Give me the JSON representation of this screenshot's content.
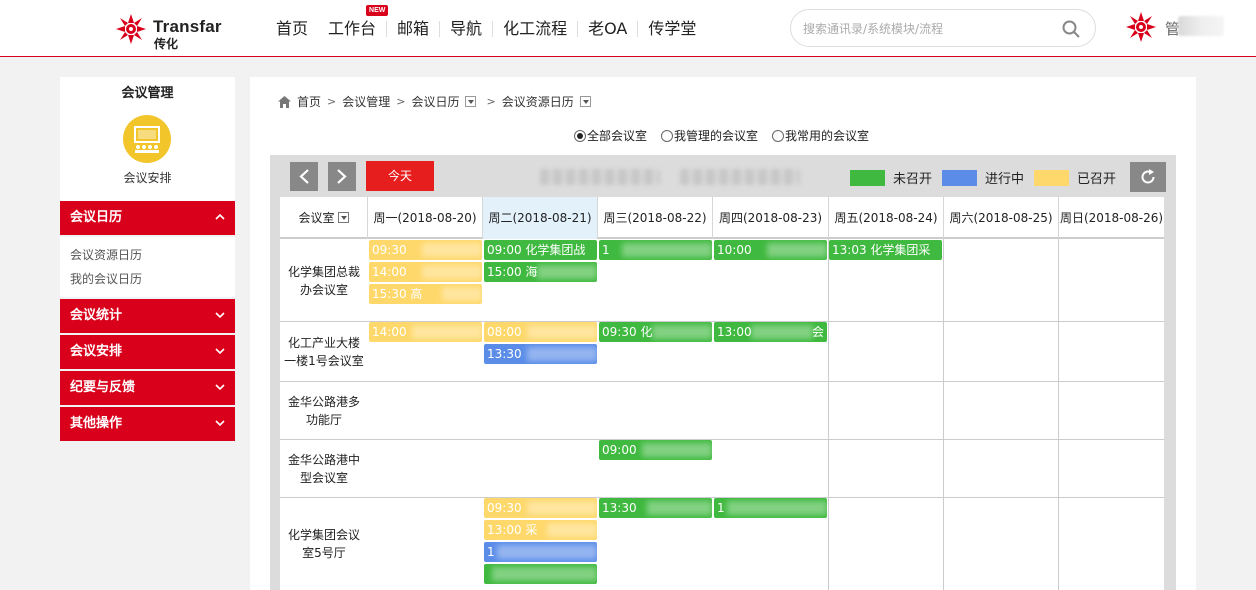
{
  "header": {
    "brand_en": "Transfar",
    "brand_cn": "传化",
    "nav": [
      {
        "label": "首页"
      },
      {
        "label": "工作台",
        "badge": "NEW"
      },
      {
        "label": "邮箱"
      },
      {
        "label": "导航"
      },
      {
        "label": "化工流程"
      },
      {
        "label": "老OA"
      },
      {
        "label": "传学堂"
      }
    ],
    "search_placeholder": "搜索通讯录/系统模块/流程",
    "user_name": "管"
  },
  "sidebar": {
    "title": "会议管理",
    "icon_label": "会议安排",
    "menus": [
      {
        "label": "会议日历",
        "expanded": true,
        "items": [
          "会议资源日历",
          "我的会议日历"
        ]
      },
      {
        "label": "会议统计"
      },
      {
        "label": "会议安排"
      },
      {
        "label": "纪要与反馈"
      },
      {
        "label": "其他操作"
      }
    ]
  },
  "breadcrumb": [
    "首页",
    "会议管理",
    "会议日历",
    "会议资源日历"
  ],
  "room_filter": {
    "options": [
      "全部会议室",
      "我管理的会议室",
      "我常用的会议室"
    ],
    "selected": "全部会议室"
  },
  "calendar": {
    "today_label": "今天",
    "legend": [
      {
        "label": "未召开",
        "color": "#3fb93f"
      },
      {
        "label": "进行中",
        "color": "#5b8de8"
      },
      {
        "label": "已召开",
        "color": "#ffd86b"
      }
    ],
    "room_header": "会议室",
    "days": [
      "周一(2018-08-20)",
      "周二(2018-08-21)",
      "周三(2018-08-22)",
      "周四(2018-08-23)",
      "周五(2018-08-24)",
      "周六(2018-08-25)",
      "周日(2018-08-26)"
    ],
    "today_index": 1,
    "rooms": [
      {
        "name": "化学集团总裁办会议室"
      },
      {
        "name": "化工产业大楼一楼1号会议室"
      },
      {
        "name": "金华公路港多功能厅"
      },
      {
        "name": "金华公路港中型会议室"
      },
      {
        "name": "化学集团会议室5号厅"
      }
    ],
    "events": {
      "e0": "09:30 ",
      "e1": "14:00 ",
      "e2": "15:30 高",
      "e3": "09:00 化学集团战",
      "e4": "15:00 海",
      "e5": "1",
      "e6": "10:00 ",
      "e7": "13:03 化学集团采",
      "e8": "14:00",
      "e9": "08:00",
      "e10": "13:30 ",
      "e11": "09:30 化",
      "e12": "13:00",
      "e13": "会",
      "e14": "09:00 ",
      "e15": "09:30",
      "e16": "13:00 采",
      "e17": "1",
      "e18": "",
      "e19": "13:30 ",
      "e20": "1"
    }
  }
}
